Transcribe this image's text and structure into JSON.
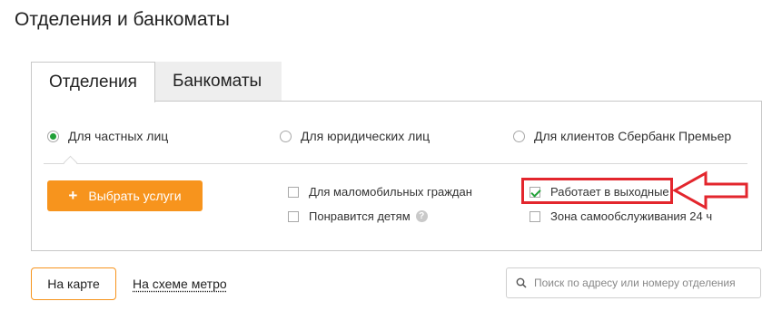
{
  "page": {
    "title": "Отделения и банкоматы"
  },
  "tabs": [
    {
      "label": "Отделения",
      "active": true
    },
    {
      "label": "Банкоматы",
      "active": false
    }
  ],
  "client_types": [
    {
      "label": "Для частных лиц",
      "selected": true
    },
    {
      "label": "Для юридических лиц",
      "selected": false
    },
    {
      "label": "Для клиентов Сбербанк Премьер",
      "selected": false
    }
  ],
  "services_button": {
    "icon": "plus-icon",
    "label": "Выбрать услуги"
  },
  "filters": [
    {
      "label": "Для маломобильных граждан",
      "checked": false
    },
    {
      "label": "Понравится детям",
      "checked": false,
      "help_icon": "?"
    },
    {
      "label": "Работает в выходные",
      "checked": true,
      "highlighted": true
    },
    {
      "label": "Зона самообслуживания 24 ч",
      "checked": false
    }
  ],
  "view": {
    "map_button": "На карте",
    "metro_link": "На схеме метро"
  },
  "search": {
    "icon": "search-icon",
    "placeholder": "Поиск по адресу или номеру отделения",
    "value": ""
  },
  "colors": {
    "accent_orange": "#f7941d",
    "accent_green": "#21a038",
    "highlight_red": "#e3262d"
  }
}
